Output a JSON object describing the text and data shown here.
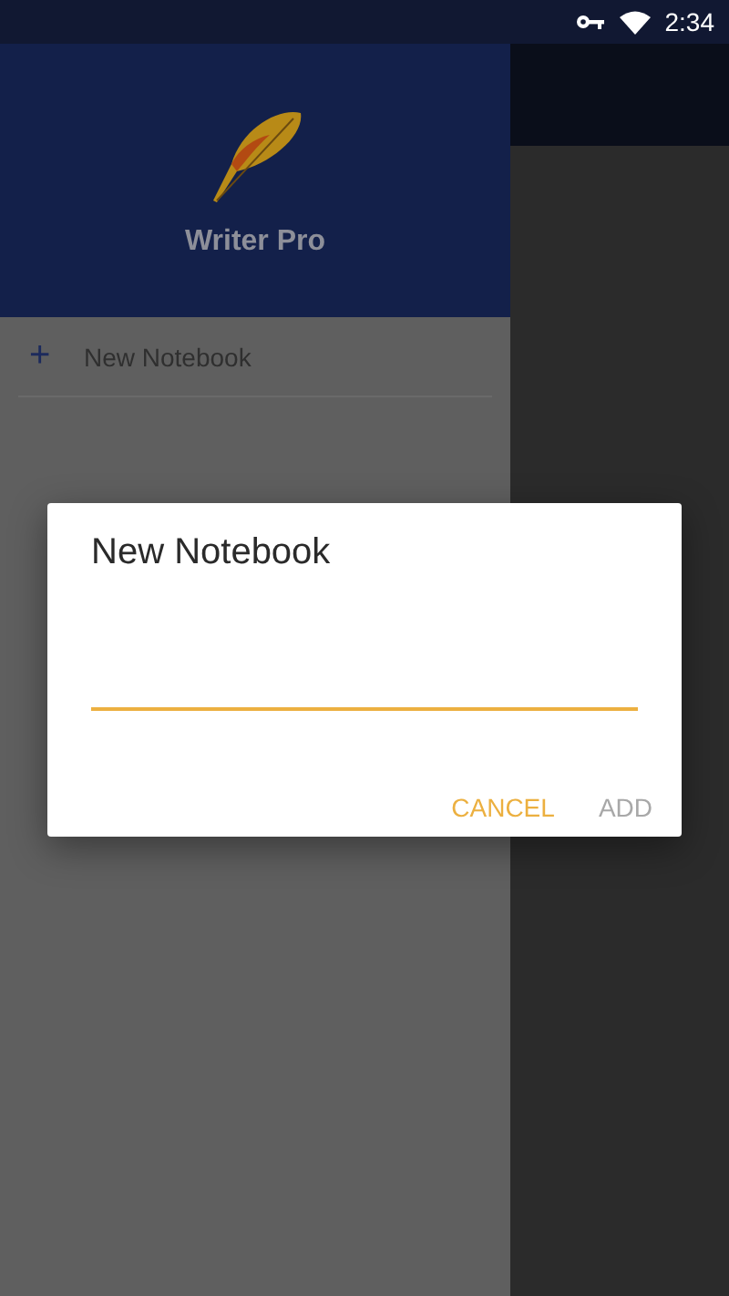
{
  "status_bar": {
    "time": "2:34"
  },
  "drawer": {
    "app_name": "Writer Pro",
    "items": [
      {
        "icon": "+",
        "label": "New Notebook"
      }
    ]
  },
  "dialog": {
    "title": "New Notebook",
    "input": {
      "focused": true
    },
    "buttons": [
      {
        "label": "CANCEL",
        "disabled": false
      },
      {
        "label": "ADD",
        "disabled": true
      }
    ]
  }
}
